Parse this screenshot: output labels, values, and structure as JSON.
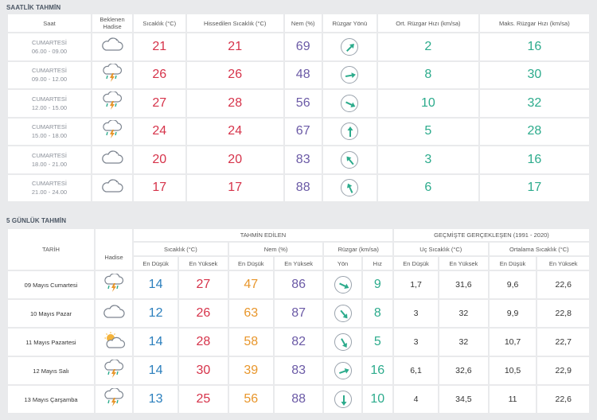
{
  "hourly": {
    "title": "SAATLİK TAHMİN",
    "headers": {
      "time": "Saat",
      "event": "Beklenen Hadise",
      "temp": "Sıcaklık (°C)",
      "feels": "Hissedilen Sıcaklık (°C)",
      "humidity": "Nem (%)",
      "wind_dir": "Rüzgar Yönü",
      "avg_wind": "Ort. Rüzgar Hızı (km/sa)",
      "max_wind": "Maks. Rüzgar Hızı (km/sa)"
    },
    "rows": [
      {
        "day": "CUMARTESİ",
        "range": "06.00 - 09.00",
        "icon": "cloudy-icon",
        "temp": "21",
        "feels": "21",
        "humidity": "69",
        "wind_deg": 45,
        "avg": "2",
        "max": "16"
      },
      {
        "day": "CUMARTESİ",
        "range": "09.00 - 12.00",
        "icon": "thunderstorm-icon",
        "temp": "26",
        "feels": "26",
        "humidity": "48",
        "wind_deg": 80,
        "avg": "8",
        "max": "30"
      },
      {
        "day": "CUMARTESİ",
        "range": "12.00 - 15.00",
        "icon": "thunderstorm-icon",
        "temp": "27",
        "feels": "28",
        "humidity": "56",
        "wind_deg": 115,
        "avg": "10",
        "max": "32"
      },
      {
        "day": "CUMARTESİ",
        "range": "15.00 - 18.00",
        "icon": "thunderstorm-icon",
        "temp": "24",
        "feels": "24",
        "humidity": "67",
        "wind_deg": 0,
        "avg": "5",
        "max": "28"
      },
      {
        "day": "CUMARTESİ",
        "range": "18.00 - 21.00",
        "icon": "cloudy-icon",
        "temp": "20",
        "feels": "20",
        "humidity": "83",
        "wind_deg": 320,
        "avg": "3",
        "max": "16"
      },
      {
        "day": "CUMARTESİ",
        "range": "21.00 - 24.00",
        "icon": "cloudy-icon",
        "temp": "17",
        "feels": "17",
        "humidity": "88",
        "wind_deg": 335,
        "avg": "6",
        "max": "17"
      }
    ]
  },
  "daily": {
    "title": "5 GÜNLÜK TAHMİN",
    "headers": {
      "date": "TARİH",
      "forecast": "TAHMİN EDİLEN",
      "history": "GEÇMİŞTE GERÇEKLEŞEN (1991 - 2020)",
      "event": "Hadise",
      "temp": "Sıcaklık (°C)",
      "humidity": "Nem (%)",
      "wind": "Rüzgar (km/sa)",
      "extreme": "Uç Sıcaklık (°C)",
      "avg_temp": "Ortalama Sıcaklık (°C)",
      "lo": "En Düşük",
      "hi": "En Yüksek",
      "dir": "Yön",
      "speed": "Hız"
    },
    "rows": [
      {
        "date": "09 Mayıs Cumartesi",
        "icon": "thunderstorm-icon",
        "tmin": "14",
        "tmax": "27",
        "hmin": "47",
        "hmax": "86",
        "wind_deg": 115,
        "speed": "9",
        "xlo": "1,7",
        "xhi": "31,6",
        "alo": "9,6",
        "ahi": "22,6"
      },
      {
        "date": "10 Mayıs Pazar",
        "icon": "cloudy-icon",
        "tmin": "12",
        "tmax": "26",
        "hmin": "63",
        "hmax": "87",
        "wind_deg": 140,
        "speed": "8",
        "xlo": "3",
        "xhi": "32",
        "alo": "9,9",
        "ahi": "22,8"
      },
      {
        "date": "11 Mayıs Pazartesi",
        "icon": "partly-cloudy-icon",
        "tmin": "14",
        "tmax": "28",
        "hmin": "58",
        "hmax": "82",
        "wind_deg": 150,
        "speed": "5",
        "xlo": "3",
        "xhi": "32",
        "alo": "10,7",
        "ahi": "22,7"
      },
      {
        "date": "12 Mayıs Salı",
        "icon": "thunderstorm-icon",
        "tmin": "14",
        "tmax": "30",
        "hmin": "39",
        "hmax": "83",
        "wind_deg": 70,
        "speed": "16",
        "xlo": "6,1",
        "xhi": "32,6",
        "alo": "10,5",
        "ahi": "22,9"
      },
      {
        "date": "13 Mayıs Çarşamba",
        "icon": "thunderstorm-icon",
        "tmin": "13",
        "tmax": "25",
        "hmin": "56",
        "hmax": "88",
        "wind_deg": 180,
        "speed": "10",
        "xlo": "4",
        "xhi": "34,5",
        "alo": "11",
        "ahi": "22,6"
      }
    ]
  }
}
